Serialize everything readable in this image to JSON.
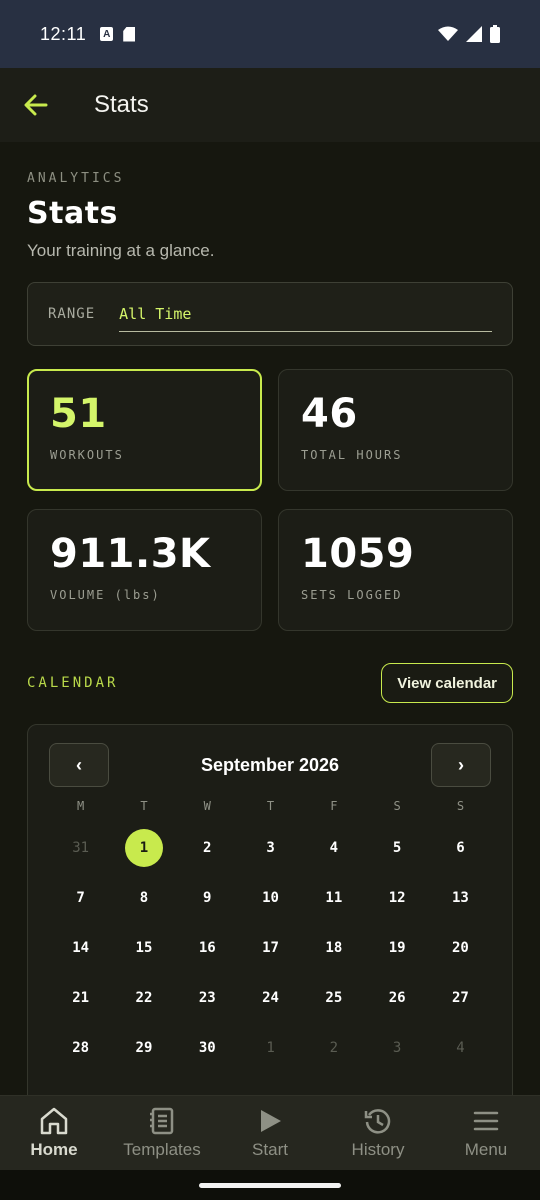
{
  "status_bar": {
    "time": "12:11",
    "a_badge": "A"
  },
  "app_bar": {
    "title": "Stats"
  },
  "header": {
    "eyebrow": "ANALYTICS",
    "title": "Stats",
    "subtitle": "Your training at a glance."
  },
  "range": {
    "label": "RANGE",
    "value": "All Time"
  },
  "stats": [
    {
      "value": "51",
      "label": "WORKOUTS"
    },
    {
      "value": "46",
      "label": "TOTAL HOURS"
    },
    {
      "value": "911.3K",
      "label": "VOLUME (lbs)"
    },
    {
      "value": "1059",
      "label": "SETS LOGGED"
    }
  ],
  "calendar": {
    "section_label": "CALENDAR",
    "view_button": "View calendar",
    "prev": "‹",
    "next": "›",
    "month": "September 2026",
    "weekdays": [
      "M",
      "T",
      "W",
      "T",
      "F",
      "S",
      "S"
    ],
    "days": [
      {
        "d": "31",
        "muted": true
      },
      {
        "d": "1",
        "today": true
      },
      {
        "d": "2"
      },
      {
        "d": "3"
      },
      {
        "d": "4"
      },
      {
        "d": "5"
      },
      {
        "d": "6"
      },
      {
        "d": "7"
      },
      {
        "d": "8"
      },
      {
        "d": "9"
      },
      {
        "d": "10"
      },
      {
        "d": "11"
      },
      {
        "d": "12"
      },
      {
        "d": "13"
      },
      {
        "d": "14"
      },
      {
        "d": "15"
      },
      {
        "d": "16"
      },
      {
        "d": "17"
      },
      {
        "d": "18"
      },
      {
        "d": "19"
      },
      {
        "d": "20"
      },
      {
        "d": "21"
      },
      {
        "d": "22"
      },
      {
        "d": "23"
      },
      {
        "d": "24"
      },
      {
        "d": "25"
      },
      {
        "d": "26"
      },
      {
        "d": "27"
      },
      {
        "d": "28"
      },
      {
        "d": "29"
      },
      {
        "d": "30"
      },
      {
        "d": "1",
        "muted": true
      },
      {
        "d": "2",
        "muted": true
      },
      {
        "d": "3",
        "muted": true
      },
      {
        "d": "4",
        "muted": true
      }
    ]
  },
  "bottom_nav": [
    {
      "label": "Home",
      "icon": "home-icon",
      "active": true
    },
    {
      "label": "Templates",
      "icon": "templates-icon"
    },
    {
      "label": "Start",
      "icon": "play-icon"
    },
    {
      "label": "History",
      "icon": "history-icon"
    },
    {
      "label": "Menu",
      "icon": "menu-icon"
    }
  ],
  "colors": {
    "accent": "#c8ea4d",
    "background": "#16170f",
    "card": "#1c1d16",
    "status_bar": "#283042"
  }
}
